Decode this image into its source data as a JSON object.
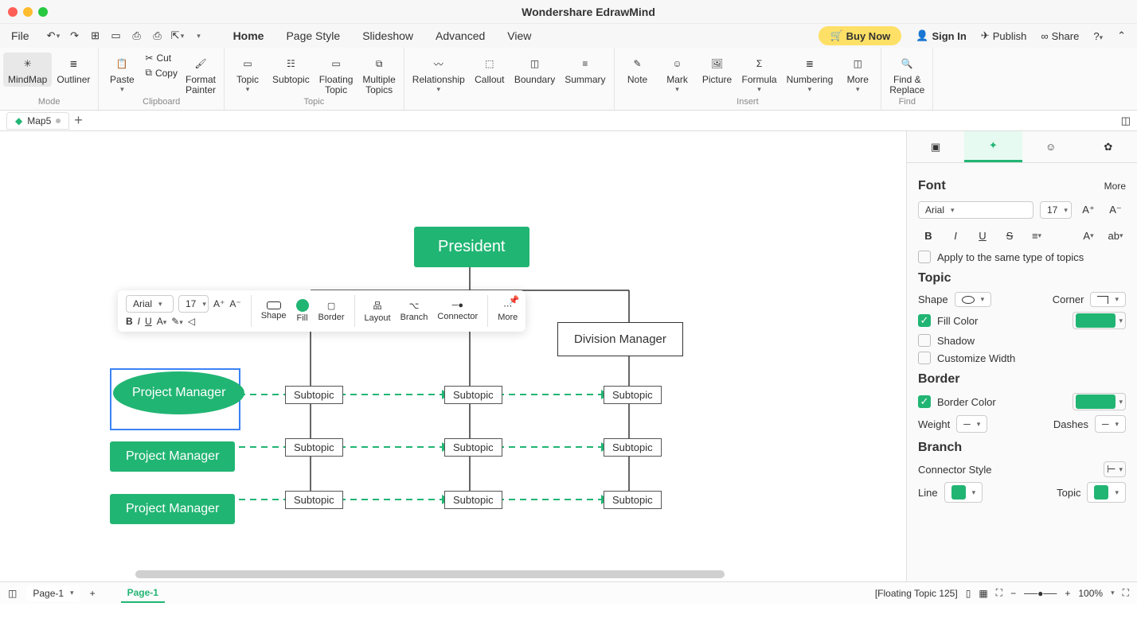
{
  "app": {
    "title": "Wondershare EdrawMind"
  },
  "menubar": {
    "file": "File",
    "tabs": [
      "Home",
      "Page Style",
      "Slideshow",
      "Advanced",
      "View"
    ],
    "active_tab": "Home",
    "buy": "Buy Now",
    "signin": "Sign In",
    "publish": "Publish",
    "share": "Share"
  },
  "ribbon": {
    "mindmap": "MindMap",
    "outliner": "Outliner",
    "mode": "Mode",
    "paste": "Paste",
    "cut": "Cut",
    "copy": "Copy",
    "format_painter": "Format\nPainter",
    "clipboard": "Clipboard",
    "topic": "Topic",
    "subtopic": "Subtopic",
    "floating": "Floating\nTopic",
    "multiple": "Multiple\nTopics",
    "topic_lbl": "Topic",
    "relationship": "Relationship",
    "callout": "Callout",
    "boundary": "Boundary",
    "summary": "Summary",
    "note": "Note",
    "mark": "Mark",
    "picture": "Picture",
    "formula": "Formula",
    "numbering": "Numbering",
    "more": "More",
    "insert": "Insert",
    "find": "Find &\nReplace",
    "find_lbl": "Find"
  },
  "doctab": {
    "name": "Map5"
  },
  "canvas": {
    "president": "President",
    "division_manager": "Division Manager",
    "project_manager": "Project Manager",
    "subtopic": "Subtopic"
  },
  "float_tb": {
    "font": "Arial",
    "size": "17",
    "shape": "Shape",
    "fill": "Fill",
    "border": "Border",
    "layout": "Layout",
    "branch": "Branch",
    "connector": "Connector",
    "more": "More"
  },
  "side": {
    "font_h": "Font",
    "more": "More",
    "font": "Arial",
    "size": "17",
    "apply": "Apply to the same type of topics",
    "topic_h": "Topic",
    "shape": "Shape",
    "corner": "Corner",
    "fill_color": "Fill Color",
    "shadow": "Shadow",
    "custom_w": "Customize Width",
    "border_h": "Border",
    "border_color": "Border Color",
    "weight": "Weight",
    "dashes": "Dashes",
    "branch_h": "Branch",
    "conn_style": "Connector Style",
    "line": "Line",
    "topic": "Topic"
  },
  "status": {
    "page_sel": "Page-1",
    "page_tab": "Page-1",
    "floating": "[Floating Topic 125]",
    "zoom": "100%"
  }
}
